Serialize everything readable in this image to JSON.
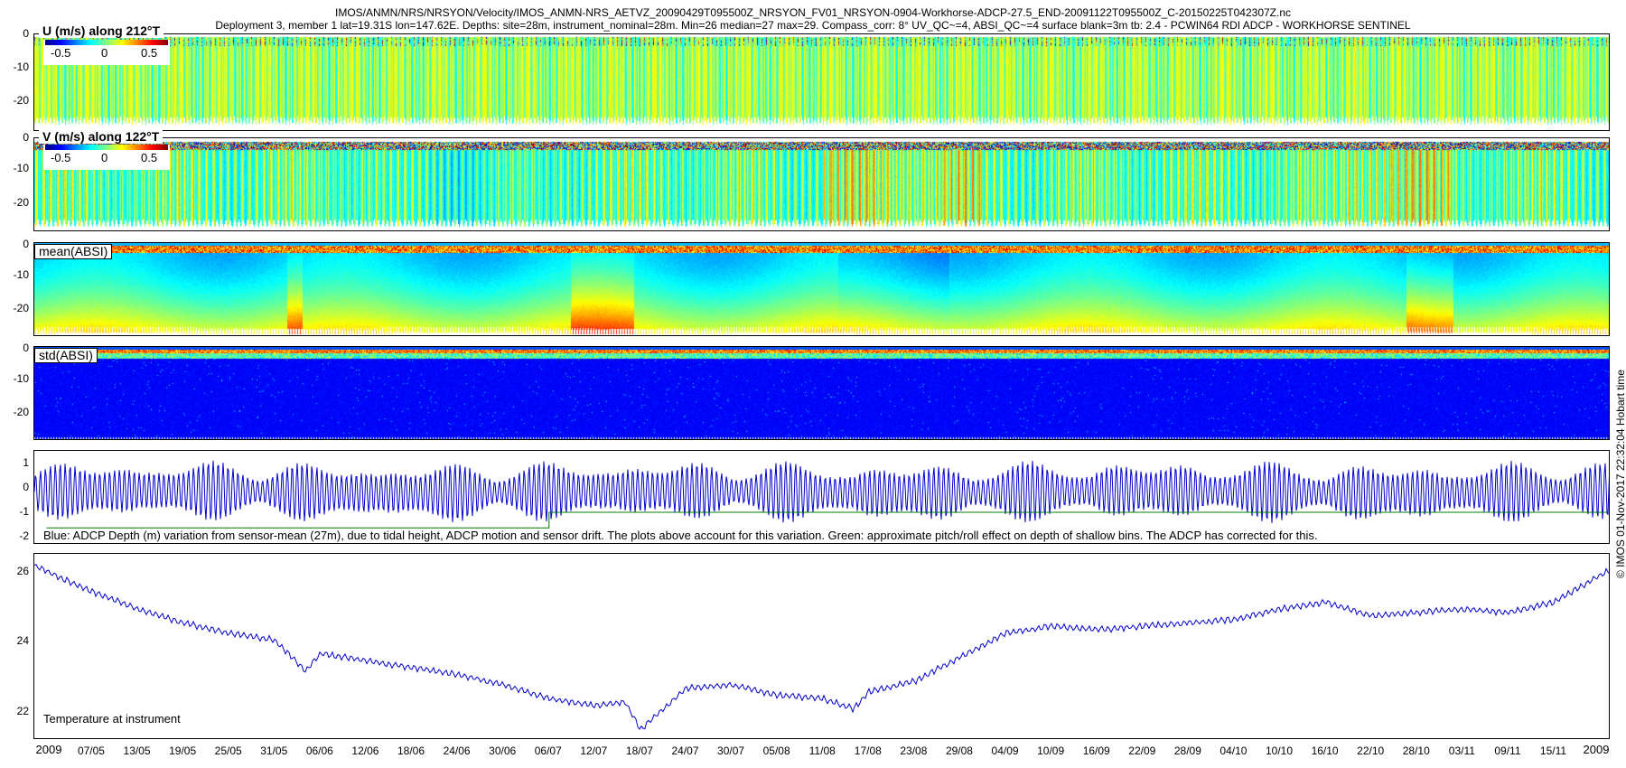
{
  "header": {
    "line1": "IMOS/ANMN/NRS/NRSYON/Velocity/IMOS_ANMN-NRS_AETVZ_20090429T095500Z_NRSYON_FV01_NRSYON-0904-Workhorse-ADCP-27.5_END-20091122T095500Z_C-20150225T042307Z.nc",
    "line2": "Deployment 3, member 1 lat=19.31S lon=147.62E. Depths: site=28m, instrument_nominal=28m. Min=26 median=27 max=29. Compass_corr: 8° UV_QC~=4, ABSI_QC~=4 surface blank=3m tb: 2.4 - PCWIN64 RDI ADCP - WORKHORSE SENTINEL"
  },
  "panels": {
    "u": {
      "label": "U (m/s) along 212°T",
      "cbar": [
        "-0.5",
        "0",
        "0.5"
      ],
      "yticks": [
        "0",
        "-10",
        "-20"
      ]
    },
    "v": {
      "label": "V (m/s) along 122°T",
      "cbar": [
        "-0.5",
        "0",
        "0.5"
      ],
      "yticks": [
        "0",
        "-10",
        "-20"
      ]
    },
    "mean": {
      "label": "mean(ABSI)",
      "yticks": [
        "0",
        "-10",
        "-20"
      ]
    },
    "std": {
      "label": "std(ABSI)",
      "yticks": [
        "0",
        "-10",
        "-20"
      ]
    },
    "depth": {
      "note": "Blue: ADCP Depth (m) variation from sensor-mean (27m), due to tidal height, ADCP motion and sensor drift. The plots above account for this variation. Green: approximate pitch/roll effect on depth of shallow bins. The ADCP has corrected for this.",
      "yticks": [
        "1",
        "0",
        "-1",
        "-2"
      ]
    },
    "temp": {
      "label": "Temperature at instrument",
      "yticks": [
        "26",
        "24",
        "22"
      ]
    }
  },
  "xaxis": {
    "year_start": "2009",
    "year_end": "2009",
    "ticks": [
      "07/05",
      "13/05",
      "19/05",
      "25/05",
      "31/05",
      "06/06",
      "12/06",
      "18/06",
      "24/06",
      "30/06",
      "06/07",
      "12/07",
      "18/07",
      "24/07",
      "30/07",
      "05/08",
      "11/08",
      "17/08",
      "23/08",
      "29/08",
      "04/09",
      "10/09",
      "16/09",
      "22/09",
      "28/09",
      "04/10",
      "10/10",
      "16/10",
      "22/10",
      "28/10",
      "03/11",
      "09/11",
      "15/11"
    ]
  },
  "credit": "© IMOS 01-Nov-2017 22:32:04 Hobart time",
  "chart_data": [
    {
      "type": "heatmap",
      "title": "U (m/s) along 212°T",
      "ylim": [
        -26,
        0
      ],
      "clim": [
        -0.7,
        0.7
      ],
      "colormap": "jet",
      "note": "mostly near zero (green) with tidal banding"
    },
    {
      "type": "heatmap",
      "title": "V (m/s) along 122°T",
      "ylim": [
        -26,
        0
      ],
      "clim": [
        -0.7,
        0.7
      ],
      "colormap": "jet",
      "note": "alternating positive/negative tidal bands with stronger positive periods in Jul-Aug and Oct"
    },
    {
      "type": "heatmap",
      "title": "mean(ABSI)",
      "ylim": [
        -26,
        0
      ],
      "colormap": "jet"
    },
    {
      "type": "heatmap",
      "title": "std(ABSI)",
      "ylim": [
        -26,
        0
      ],
      "colormap": "jet"
    },
    {
      "type": "line",
      "title": "ADCP Depth variation (m)",
      "ylim": [
        -2.2,
        1.7
      ],
      "series": [
        {
          "color": "#0000cc",
          "description": "tidal oscillation, amplitude ~0.6-1.5 m, spring-neap modulation"
        },
        {
          "color": "#007f00",
          "x": [
            "2009-05-01",
            "2009-07-06",
            "2009-07-06",
            "2009-11-22"
          ],
          "values": [
            -1.5,
            -1.5,
            -0.85,
            -0.85
          ]
        }
      ]
    },
    {
      "type": "line",
      "title": "Temperature at instrument",
      "ylim": [
        21.8,
        27.2
      ],
      "series": [
        {
          "color": "#0000cc",
          "x": [
            "2009-04-29",
            "2009-05-07",
            "2009-05-13",
            "2009-05-19",
            "2009-05-25",
            "2009-05-31",
            "2009-06-04",
            "2009-06-06",
            "2009-06-12",
            "2009-06-18",
            "2009-06-24",
            "2009-06-30",
            "2009-07-06",
            "2009-07-12",
            "2009-07-16",
            "2009-07-18",
            "2009-07-20",
            "2009-07-24",
            "2009-07-30",
            "2009-08-05",
            "2009-08-11",
            "2009-08-15",
            "2009-08-17",
            "2009-08-23",
            "2009-08-29",
            "2009-09-04",
            "2009-09-10",
            "2009-09-16",
            "2009-09-22",
            "2009-09-28",
            "2009-10-04",
            "2009-10-10",
            "2009-10-16",
            "2009-10-22",
            "2009-10-28",
            "2009-11-03",
            "2009-11-09",
            "2009-11-15",
            "2009-11-22"
          ],
          "values": [
            26.9,
            26.1,
            25.6,
            25.2,
            24.9,
            24.7,
            23.8,
            24.3,
            24.1,
            23.9,
            23.7,
            23.4,
            23.0,
            22.8,
            22.9,
            22.1,
            22.5,
            23.3,
            23.4,
            23.1,
            23.0,
            22.7,
            23.2,
            23.5,
            24.2,
            24.9,
            25.1,
            25.0,
            25.1,
            25.2,
            25.3,
            25.6,
            25.8,
            25.4,
            25.5,
            25.6,
            25.5,
            25.8,
            26.7
          ]
        }
      ]
    }
  ]
}
